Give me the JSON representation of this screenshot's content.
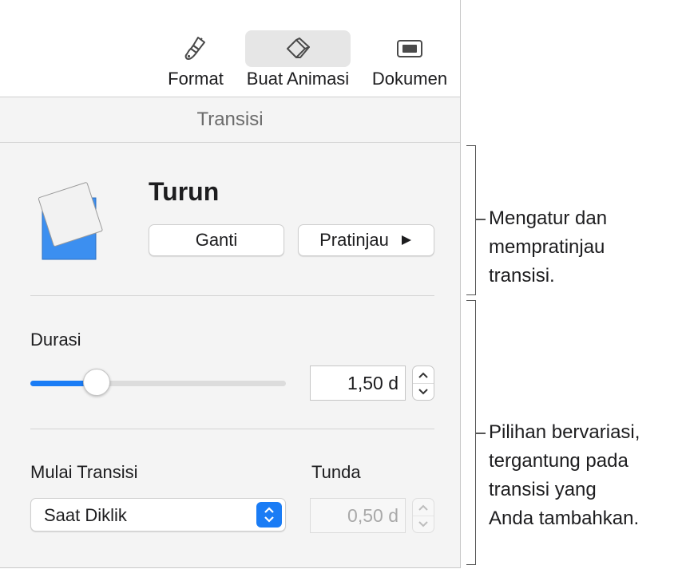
{
  "toolbar": {
    "items": [
      {
        "label": "Format",
        "icon": "paintbrush-icon",
        "active": false
      },
      {
        "label": "Buat Animasi",
        "icon": "diamond-icon",
        "active": true
      },
      {
        "label": "Dokumen",
        "icon": "document-icon",
        "active": false
      }
    ]
  },
  "tab_header": "Transisi",
  "transition": {
    "name": "Turun",
    "change_label": "Ganti",
    "preview_label": "Pratinjau",
    "preview_icon": "play-icon"
  },
  "duration": {
    "label": "Durasi",
    "value": "1,50 d",
    "slider_fraction": 0.26
  },
  "start": {
    "label": "Mulai Transisi",
    "selected": "Saat Diklik"
  },
  "delay": {
    "label": "Tunda",
    "value": "0,50 d",
    "disabled": true
  },
  "callouts": [
    {
      "lines": [
        "Mengatur dan",
        "mempratinjau",
        "transisi."
      ]
    },
    {
      "lines": [
        "Pilihan bervariasi,",
        "tergantung pada",
        "transisi yang",
        "Anda tambahkan."
      ]
    }
  ],
  "colors": {
    "accent": "#1a7cf5",
    "thumb_blue": "#3c8ff0"
  }
}
